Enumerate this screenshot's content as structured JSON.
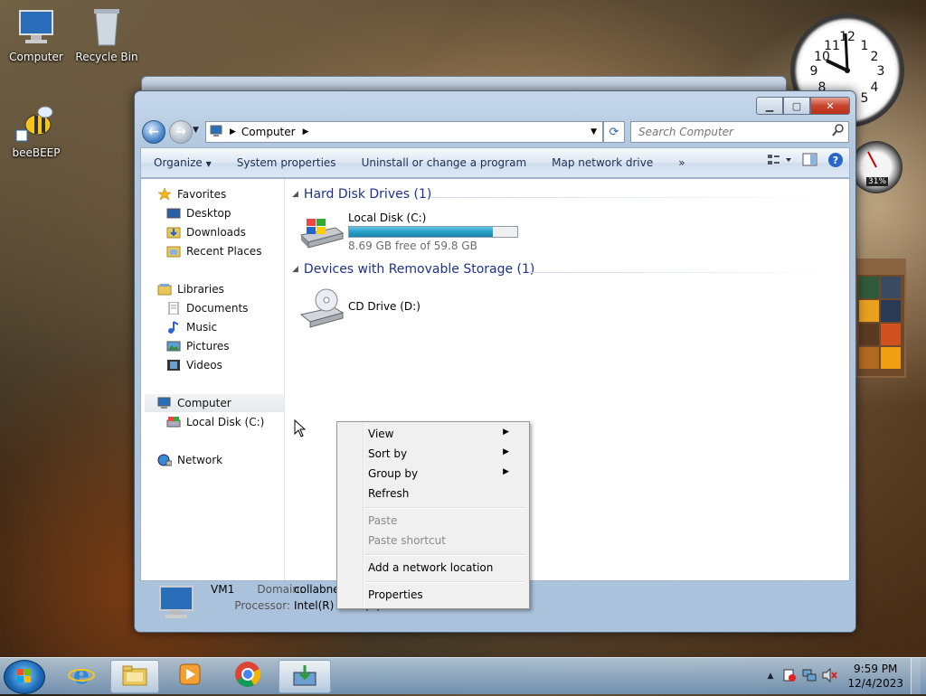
{
  "desktop": {
    "icons": [
      {
        "label": "Computer"
      },
      {
        "label": "Recycle Bin"
      },
      {
        "label": "beeBEEP"
      }
    ]
  },
  "gadgets": {
    "cpu_percent": "31%"
  },
  "window": {
    "address": {
      "crumb": "Computer"
    },
    "search": {
      "placeholder": "Search Computer"
    },
    "toolbar": {
      "organize": "Organize",
      "system_properties": "System properties",
      "uninstall": "Uninstall or change a program",
      "map_drive": "Map network drive",
      "more": "»"
    },
    "nav": {
      "favorites": "Favorites",
      "desktop": "Desktop",
      "downloads": "Downloads",
      "recent": "Recent Places",
      "libraries": "Libraries",
      "documents": "Documents",
      "music": "Music",
      "pictures": "Pictures",
      "videos": "Videos",
      "computer": "Computer",
      "local_disk": "Local Disk (C:)",
      "network": "Network"
    },
    "groups": {
      "hdd": "Hard Disk Drives (1)",
      "removable": "Devices with Removable Storage (1)"
    },
    "drives": {
      "c_name": "Local Disk (C:)",
      "c_free": "8.69 GB free of 59.8 GB",
      "c_used_fraction": 0.855,
      "d_name": "CD Drive (D:)"
    },
    "details": {
      "name": "VM1",
      "domain_label": "Domain:",
      "domain_value": "collabnet",
      "processor_label": "Processor:",
      "processor_value": "Intel(R) Xeon(R) CPU E5..."
    }
  },
  "context_menu": {
    "view": "View",
    "sort_by": "Sort by",
    "group_by": "Group by",
    "refresh": "Refresh",
    "paste": "Paste",
    "paste_shortcut": "Paste shortcut",
    "add_network": "Add a network location",
    "properties": "Properties"
  },
  "taskbar": {
    "time": "9:59 PM",
    "date": "12/4/2023"
  }
}
